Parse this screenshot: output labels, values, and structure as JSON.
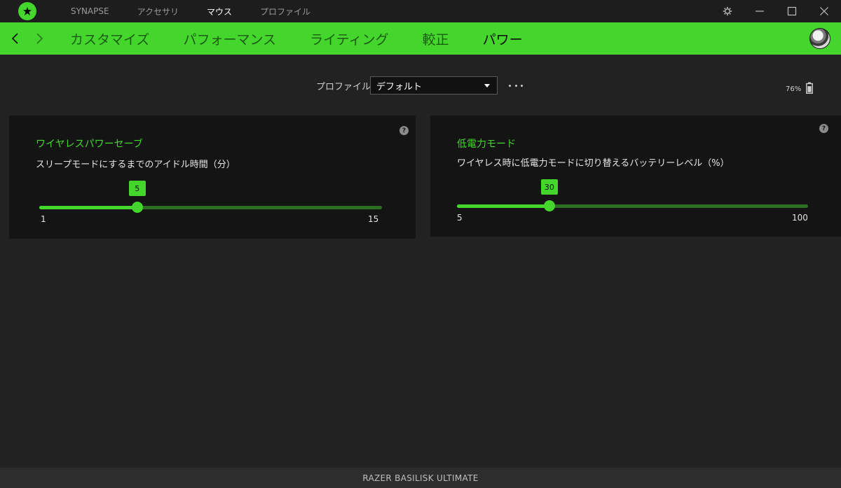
{
  "app": {
    "top_nav": [
      {
        "label": "SYNAPSE",
        "active": false
      },
      {
        "label": "アクセサリ",
        "active": false
      },
      {
        "label": "マウス",
        "active": true
      },
      {
        "label": "プロファイル",
        "active": false
      }
    ]
  },
  "sub_nav": {
    "tabs": [
      {
        "label": "カスタマイズ",
        "active": false
      },
      {
        "label": "パフォーマンス",
        "active": false
      },
      {
        "label": "ライティング",
        "active": false
      },
      {
        "label": "較正",
        "active": false
      },
      {
        "label": "パワー",
        "active": true
      }
    ]
  },
  "profile": {
    "label": "プロファイル",
    "selected": "デフォルト"
  },
  "battery": {
    "percent_text": "76%",
    "level": 0.76
  },
  "cards": {
    "wireless_power_save": {
      "help": "?",
      "title": "ワイヤレスパワーセーブ",
      "description": "スリープモードにするまでのアイドル時間（分）",
      "min": 1,
      "max": 15,
      "value": 5,
      "min_label": "1",
      "max_label": "15",
      "value_label": "5"
    },
    "low_power_mode": {
      "help": "?",
      "title": "低電力モード",
      "description": "ワイヤレス時に低電力モードに切り替えるバッテリーレベル（%）",
      "min": 5,
      "max": 100,
      "value": 30,
      "min_label": "5",
      "max_label": "100",
      "value_label": "30"
    }
  },
  "footer": {
    "device_name": "RAZER BASILISK ULTIMATE"
  },
  "colors": {
    "accent": "#44d62c",
    "background": "#222222",
    "card": "#141414",
    "titlebar": "#1d1d1d"
  }
}
